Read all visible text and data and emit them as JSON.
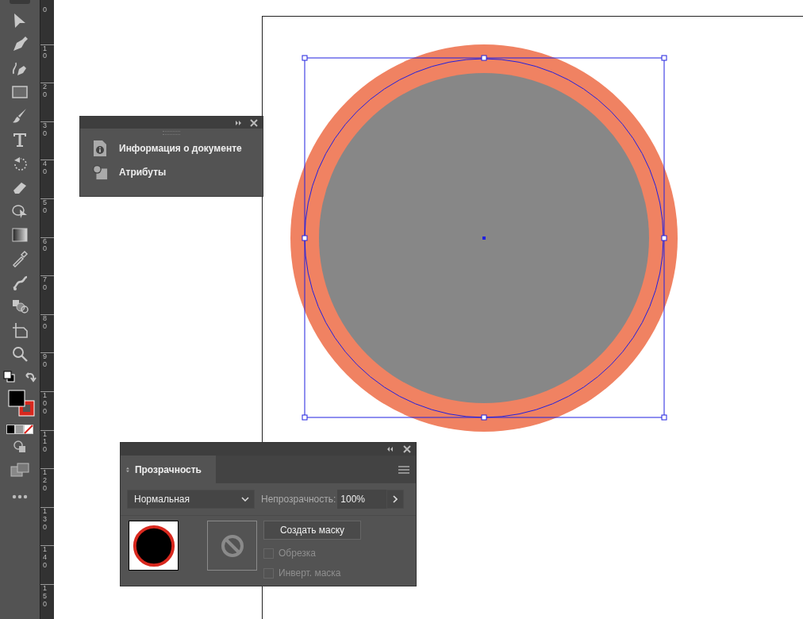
{
  "ruler": {
    "labels": [
      "0",
      "10",
      "20",
      "30",
      "40",
      "50",
      "60",
      "70",
      "80",
      "90",
      "100",
      "110",
      "120",
      "130",
      "140",
      "150"
    ]
  },
  "doc_panel": {
    "items": [
      {
        "kind": "info",
        "label": "Информация о документе"
      },
      {
        "kind": "attributes",
        "label": "Атрибуты"
      }
    ]
  },
  "transparency_panel": {
    "tab": {
      "label": "Прозрачность",
      "selected": true
    },
    "blend_mode": "Нормальная",
    "opacity_label": "Непрозрачность:",
    "opacity_value": "100%",
    "make_mask_button": "Создать маску",
    "options": [
      {
        "label": "Обрезка",
        "checked": false,
        "disabled": true
      },
      {
        "label": "Инверт. маска",
        "checked": false,
        "disabled": true
      }
    ]
  }
}
